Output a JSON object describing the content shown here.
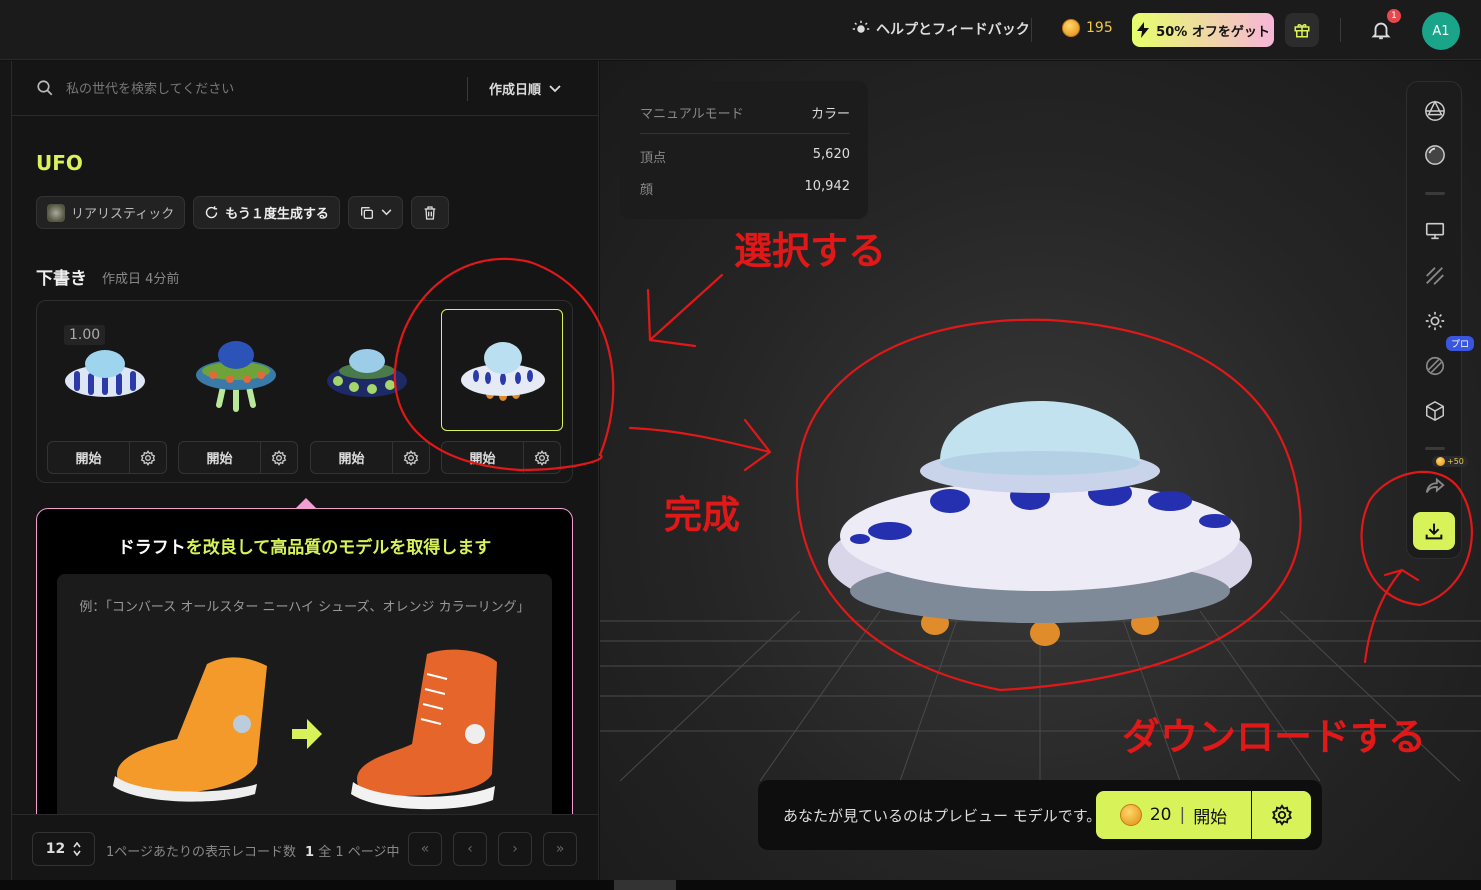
{
  "topbar": {
    "help_label": "ヘルプとフィードバック",
    "credits": "195",
    "promo_label": "50% オフをゲット",
    "notification_count": "1",
    "avatar_initials": "A1"
  },
  "search": {
    "placeholder": "私の世代を検索してください",
    "sort_label": "作成日順"
  },
  "item": {
    "title": "UFO",
    "style_label": "リアリスティック",
    "regenerate_label": "もう１度生成する"
  },
  "drafts": {
    "section_label": "下書き",
    "created_label": "作成日 4分前",
    "score": "1.00",
    "items": [
      {
        "start_label": "開始"
      },
      {
        "start_label": "開始"
      },
      {
        "start_label": "開始"
      },
      {
        "start_label": "開始"
      }
    ],
    "selected_index": 3
  },
  "refine": {
    "title_part1": "ドラフト",
    "title_part2": "を改良して",
    "title_part3": "高品質のモデルを取得します",
    "example_text": "例：「コンバース オールスター ニーハイ シューズ、オレンジ カラーリング」"
  },
  "pagination": {
    "page_size": "12",
    "page_size_label": "1ページあたりの表示レコード数",
    "current_page": "1",
    "page_info": "全 1 ページ中"
  },
  "viewer": {
    "mode_label": "マニュアルモード",
    "mode_value": "カラー",
    "vertices_label": "頂点",
    "vertices_value": "5,620",
    "faces_label": "顔",
    "faces_value": "10,942",
    "pro_badge": "プロ",
    "share_cost": "+50",
    "preview_text": "あなたが見ているのはプレビュー モデルです。",
    "start_cost": "20",
    "start_label": "開始"
  },
  "annotations": {
    "select": "選択する",
    "complete": "完成",
    "download": "ダウンロードする"
  },
  "colors": {
    "accent": "#d8f35a",
    "annotation_red": "#e01818",
    "refine_border": "#f29ed0"
  }
}
